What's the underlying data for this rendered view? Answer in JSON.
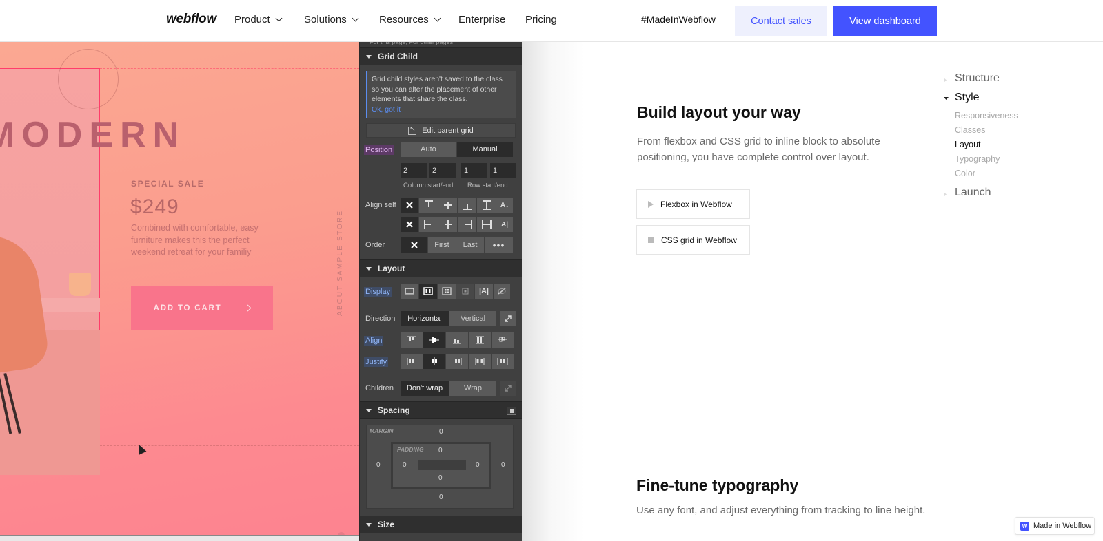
{
  "nav": {
    "logo": "webflow",
    "items": [
      {
        "label": "Product",
        "dropdown": true
      },
      {
        "label": "Solutions",
        "dropdown": true
      },
      {
        "label": "Resources",
        "dropdown": true
      },
      {
        "label": "Enterprise",
        "dropdown": false
      },
      {
        "label": "Pricing",
        "dropdown": false
      }
    ],
    "made_in_webflow": "#MadeInWebflow",
    "contact_sales": "Contact sales",
    "view_dashboard": "View dashboard",
    "accent_color": "#4353ff"
  },
  "canvas": {
    "hero_word": "MODERN",
    "sale_label": "SPECIAL SALE",
    "price": "$249",
    "description": "Combined with comfortable, easy furniture makes this the perfect weekend retreat for your familiy",
    "cart_button": "ADD TO CART",
    "side_text": "ABOUT SAMPLE STORE"
  },
  "panel": {
    "top_text": "For this page, For other pages",
    "grid_child": {
      "title": "Grid Child",
      "note": "Grid child styles aren't saved to the class so you can alter the placement of other elements that share the class.",
      "note_link": "Ok, got it",
      "edit_parent": "Edit parent grid",
      "position_label": "Position",
      "position_options": [
        "Auto",
        "Manual"
      ],
      "position_selected": "Manual",
      "column_start": "2",
      "column_end": "2",
      "row_start": "1",
      "row_end": "1",
      "column_label": "Column start/end",
      "row_label": "Row start/end",
      "align_self_label": "Align self",
      "order_label": "Order",
      "order_options": [
        "First",
        "Last"
      ]
    },
    "layout": {
      "title": "Layout",
      "display_label": "Display",
      "display_options": [
        "block-icon",
        "flex-icon",
        "grid-icon",
        "inline-block-icon",
        "inline-icon",
        "none-icon"
      ],
      "display_selected": "flex-icon",
      "direction_label": "Direction",
      "direction_options": [
        "Horizontal",
        "Vertical"
      ],
      "direction_selected": "Horizontal",
      "align_label": "Align",
      "align_selected_index": 1,
      "justify_label": "Justify",
      "justify_selected_index": 1,
      "children_label": "Children",
      "children_options": [
        "Don't wrap",
        "Wrap"
      ],
      "children_selected": "Don't wrap"
    },
    "spacing": {
      "title": "Spacing",
      "margin_label": "MARGIN",
      "padding_label": "PADDING",
      "margin": {
        "top": "0",
        "right": "0",
        "bottom": "0",
        "left": "0"
      },
      "padding": {
        "top": "0",
        "right": "0",
        "bottom": "0",
        "left": "0"
      }
    },
    "size": {
      "title": "Size"
    }
  },
  "content": {
    "build_title": "Build layout your way",
    "build_text": "From flexbox and CSS grid to inline block to absolute positioning, you have complete control over layout.",
    "links": [
      {
        "label": "Flexbox in Webflow",
        "icon": "pointer-icon"
      },
      {
        "label": "CSS grid in Webflow",
        "icon": "grid-icon"
      }
    ],
    "fine_title": "Fine-tune typography",
    "fine_text": "Use any font, and adjust everything from tracking to line height."
  },
  "toc": {
    "structure": "Structure",
    "style": "Style",
    "style_items": [
      "Responsiveness",
      "Classes",
      "Layout",
      "Typography",
      "Color"
    ],
    "style_active": "Layout",
    "launch": "Launch"
  },
  "badge": {
    "label": "Made in Webflow",
    "icon_letter": "W"
  }
}
